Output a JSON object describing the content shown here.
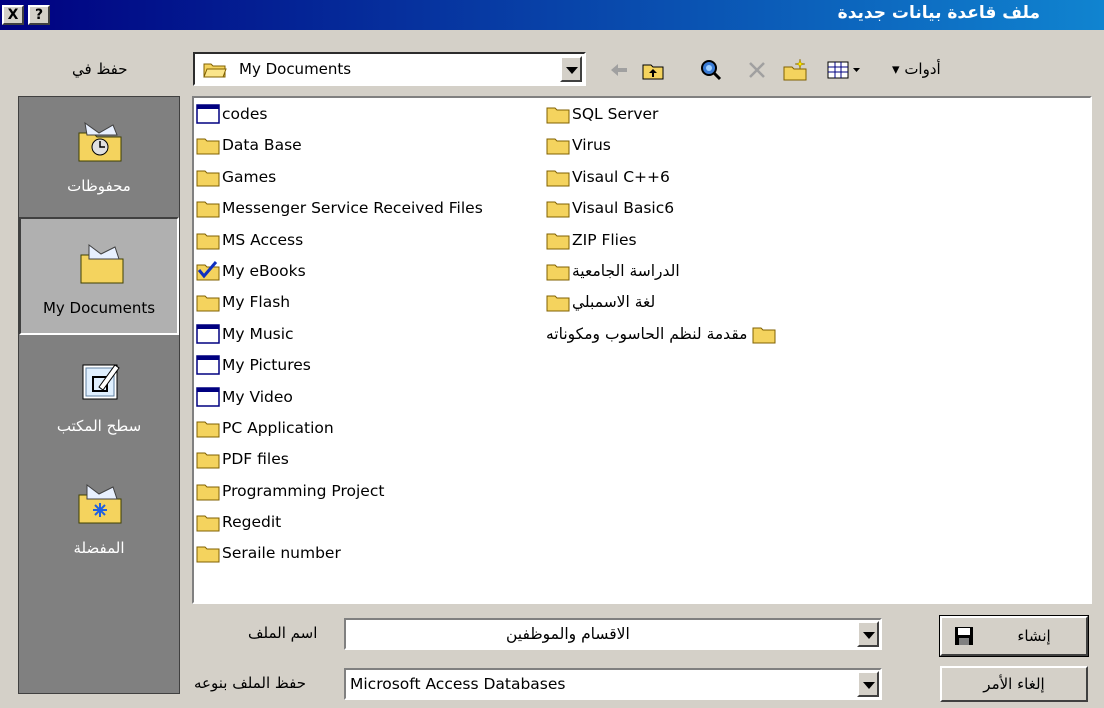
{
  "window": {
    "title": "ملف قاعدة بيانات جديدة",
    "help_button": "?",
    "close_button": "X"
  },
  "toolbar": {
    "save_in_label": "حفظ في",
    "save_in_value": "My Documents",
    "tools_label": "أدوات",
    "icons": [
      "back-icon",
      "up-folder-icon",
      "search-web-icon",
      "delete-icon",
      "new-folder-icon",
      "views-icon"
    ]
  },
  "places": [
    {
      "label": "محفوظات",
      "icon": "history-icon"
    },
    {
      "label": "My Documents",
      "icon": "my-documents-icon",
      "active": true
    },
    {
      "label": "سطح المكتب",
      "icon": "desktop-icon"
    },
    {
      "label": "المفضلة",
      "icon": "favorites-icon"
    }
  ],
  "files_left": [
    {
      "name": "codes",
      "icon": "window-folder"
    },
    {
      "name": "Data Base",
      "icon": "folder"
    },
    {
      "name": "Games",
      "icon": "folder"
    },
    {
      "name": "Messenger Service Received Files",
      "icon": "folder"
    },
    {
      "name": "MS Access",
      "icon": "folder"
    },
    {
      "name": "My eBooks",
      "icon": "checked-folder"
    },
    {
      "name": "My Flash",
      "icon": "folder"
    },
    {
      "name": "My Music",
      "icon": "window-folder"
    },
    {
      "name": "My Pictures",
      "icon": "window-folder"
    },
    {
      "name": "My Video",
      "icon": "window-folder"
    },
    {
      "name": "PC Application",
      "icon": "folder"
    },
    {
      "name": "PDF files",
      "icon": "folder"
    },
    {
      "name": "Programming Project",
      "icon": "folder"
    },
    {
      "name": "Regedit",
      "icon": "folder"
    },
    {
      "name": "Seraile number",
      "icon": "folder"
    }
  ],
  "files_right": [
    {
      "name": "SQL Server",
      "icon": "folder"
    },
    {
      "name": "Virus",
      "icon": "folder"
    },
    {
      "name": "Visaul  C++6",
      "icon": "folder"
    },
    {
      "name": "Visaul Basic6",
      "icon": "folder"
    },
    {
      "name": "ZIP Flies",
      "icon": "folder"
    },
    {
      "name": "الدراسة الجامعية",
      "icon": "folder"
    },
    {
      "name": "لغة الاسمبلي",
      "icon": "folder"
    },
    {
      "name": "مقدمة لنظم الحاسوب ومكوناته",
      "icon": "folder"
    }
  ],
  "file_name": {
    "label": "اسم الملف",
    "value": "الاقسام والموظفين"
  },
  "file_type": {
    "label": "حفظ الملف بنوعه",
    "value": "Microsoft Access Databases"
  },
  "buttons": {
    "create": "إنشاء",
    "cancel": "إلغاء الأمر"
  },
  "colors": {
    "title_start": "#000080",
    "title_end": "#1084d0",
    "face": "#d4d0c8",
    "places_bg": "#808080",
    "folder": "#f4d35e"
  }
}
